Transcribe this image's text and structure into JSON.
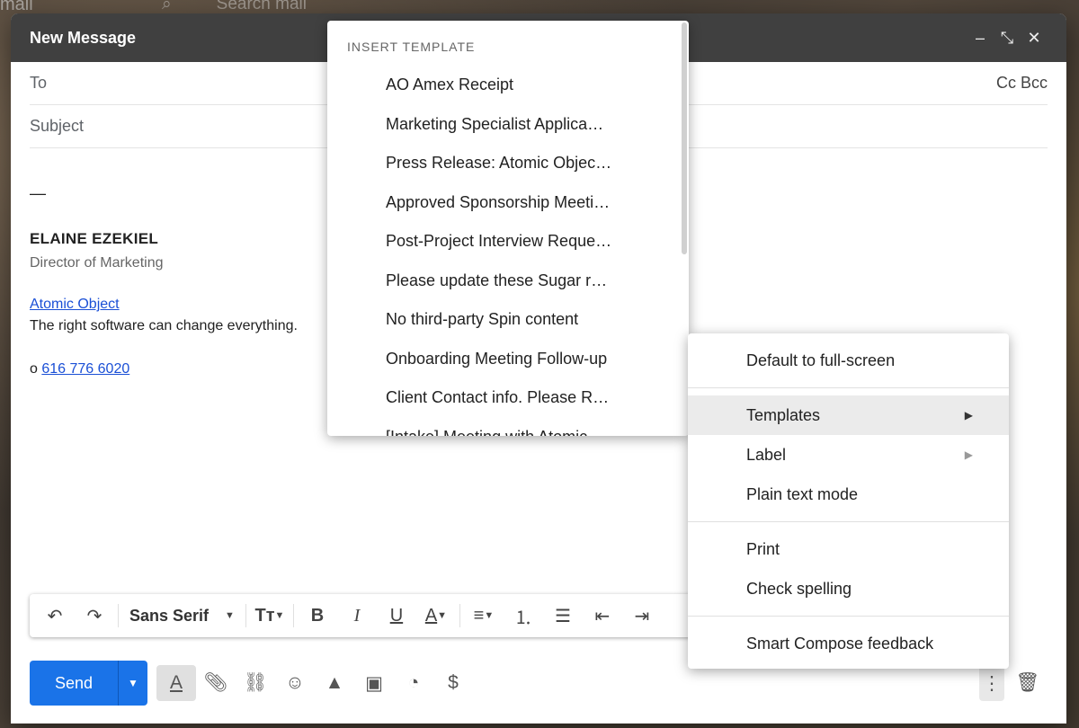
{
  "background": {
    "app_title": "mail",
    "search_placeholder": "Search mail"
  },
  "compose": {
    "title": "New Message",
    "controls": [
      "–",
      "⤡",
      "✕"
    ],
    "to_label": "To",
    "cc_bcc": "Cc Bcc",
    "subject_label": "Subject",
    "signature": {
      "dash": "—",
      "name": "ELAINE EZEKIEL",
      "role": "Director of Marketing",
      "company": "Atomic Object",
      "tagline": "The right software can change everything.",
      "phone_prefix": "o",
      "phone": "616 776 6020"
    }
  },
  "toolbar": {
    "font": "Sans Serif"
  },
  "bottom_bar": {
    "send_label": "Send"
  },
  "template_menu": {
    "header": "INSERT TEMPLATE",
    "items": [
      "AO Amex Receipt",
      "Marketing Specialist Applica…",
      "Press Release: Atomic Objec…",
      "Approved Sponsorship Meeti…",
      "Post-Project Interview Reque…",
      "Please update these Sugar r…",
      "No third-party Spin content",
      "Onboarding Meeting Follow-up",
      "Client Contact info. Please R…",
      "[Intake] Meeting with Atomic…"
    ]
  },
  "more_menu": {
    "items": [
      "Default to full-screen",
      "Templates",
      "Label",
      "Plain text mode",
      "Print",
      "Check spelling",
      "Smart Compose feedback"
    ]
  }
}
